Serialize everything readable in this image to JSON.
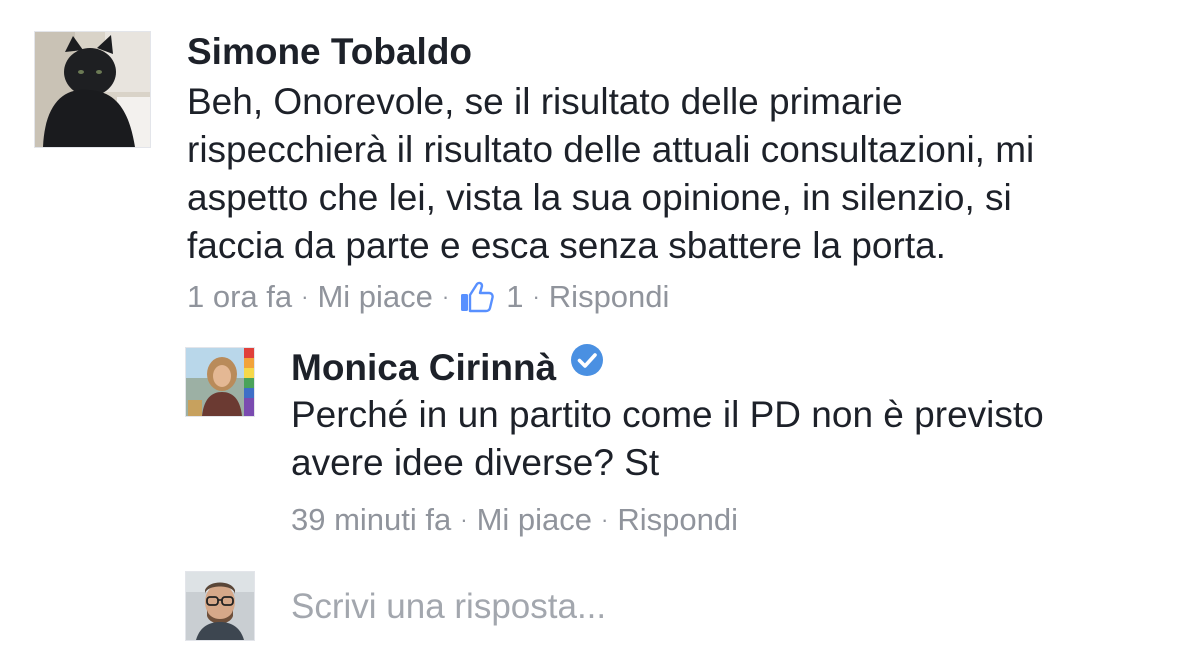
{
  "comment": {
    "author": "Simone Tobaldo",
    "text_lines": [
      "Beh, Onorevole, se il risultato delle primarie",
      "rispecchierà il risultato delle attuali consultazioni, mi",
      "aspetto che lei, vista la sua opinione, in silenzio, si",
      "faccia da parte e esca senza sbattere la porta."
    ],
    "time": "1 ora fa",
    "like_label": "Mi piace",
    "like_count": "1",
    "reply_label": "Rispondi",
    "separator": "·"
  },
  "reply": {
    "author": "Monica Cirinnà",
    "verified": true,
    "text_lines": [
      "Perché in un partito come il PD non è previsto",
      "avere idee diverse? St"
    ],
    "time": "39 minuti fa",
    "like_label": "Mi piace",
    "reply_label": "Rispondi",
    "separator": "·"
  },
  "reply_box": {
    "placeholder": "Scrivi una risposta..."
  },
  "icons": {
    "like": "thumbs-up-icon",
    "verified": "verified-badge-icon"
  },
  "colors": {
    "text": "#1d2129",
    "meta": "#90949c",
    "placeholder": "#a3a7ae",
    "like_blue": "#5890ff",
    "verified_blue": "#4a90e2"
  }
}
